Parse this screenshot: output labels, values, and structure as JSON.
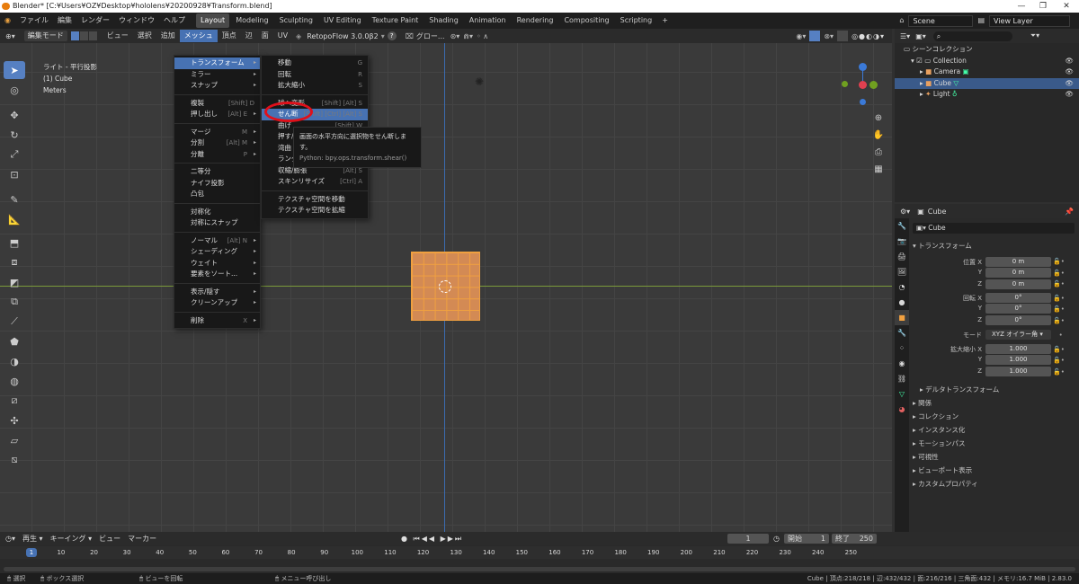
{
  "window": {
    "title": "Blender* [C:¥Users¥OZ¥Desktop¥hololens¥20200928¥Transform.blend]",
    "minimize": "—",
    "maximize": "❐",
    "close": "✕"
  },
  "topbar": {
    "menus": [
      "ファイル",
      "編集",
      "レンダー",
      "ウィンドウ",
      "ヘルプ"
    ],
    "workspaces": [
      "Layout",
      "Modeling",
      "Sculpting",
      "UV Editing",
      "Texture Paint",
      "Shading",
      "Animation",
      "Rendering",
      "Compositing",
      "Scripting"
    ],
    "active_workspace": "Layout",
    "scene": "Scene",
    "view_layer": "View Layer"
  },
  "viewport_header": {
    "mode": "編集モード",
    "menus": [
      "ビュー",
      "選択",
      "追加",
      "メッシュ",
      "頂点",
      "辺",
      "面",
      "UV"
    ],
    "addon": "RetopoFlow 3.0.0β2",
    "transform_orientation": "グロー...",
    "options": "オプション"
  },
  "viewport_info": {
    "line1": "ライト - 平行投影",
    "line2": "(1) Cube",
    "line3": "Meters"
  },
  "mesh_menu": {
    "items": [
      {
        "label": "トランスフォーム",
        "shortcut": "",
        "submenu": true,
        "highlight": true
      },
      {
        "label": "ミラー",
        "shortcut": "",
        "submenu": true
      },
      {
        "label": "スナップ",
        "shortcut": "",
        "submenu": true
      },
      {
        "sep": true
      },
      {
        "label": "複製",
        "shortcut": "[Shift] D"
      },
      {
        "label": "押し出し",
        "shortcut": "[Alt] E",
        "submenu": true
      },
      {
        "sep": true
      },
      {
        "label": "マージ",
        "shortcut": "M",
        "submenu": true
      },
      {
        "label": "分割",
        "shortcut": "[Alt] M",
        "submenu": true
      },
      {
        "label": "分離",
        "shortcut": "P",
        "submenu": true
      },
      {
        "sep": true
      },
      {
        "label": "二等分",
        "shortcut": ""
      },
      {
        "label": "ナイフ投影",
        "shortcut": ""
      },
      {
        "label": "凸包",
        "shortcut": ""
      },
      {
        "sep": true
      },
      {
        "label": "対称化",
        "shortcut": ""
      },
      {
        "label": "対称にスナップ",
        "shortcut": ""
      },
      {
        "sep": true
      },
      {
        "label": "ノーマル",
        "shortcut": "[Alt] N",
        "submenu": true
      },
      {
        "label": "シェーディング",
        "shortcut": "",
        "submenu": true
      },
      {
        "label": "ウェイト",
        "shortcut": "",
        "submenu": true
      },
      {
        "label": "要素をソート...",
        "shortcut": "",
        "submenu": true
      },
      {
        "sep": true
      },
      {
        "label": "表示/隠す",
        "shortcut": "",
        "submenu": true
      },
      {
        "label": "クリーンアップ",
        "shortcut": "",
        "submenu": true
      },
      {
        "sep": true
      },
      {
        "label": "削除",
        "shortcut": "X",
        "submenu": true
      }
    ]
  },
  "transform_submenu": {
    "items": [
      {
        "label": "移動",
        "shortcut": "G"
      },
      {
        "label": "回転",
        "shortcut": "R"
      },
      {
        "label": "拡大縮小",
        "shortcut": "S"
      },
      {
        "sep": true
      },
      {
        "label": "球へ変形",
        "shortcut": "[Shift] [Alt] S"
      },
      {
        "label": "せん断",
        "shortcut": "[Shift] [Ctrl] [Alt] S",
        "highlight": true
      },
      {
        "label": "曲げ",
        "shortcut": "[Shift] W"
      },
      {
        "label": "押す/引く",
        "shortcut": ""
      },
      {
        "label": "湾曲",
        "shortcut": ""
      },
      {
        "label": "ランダム化",
        "shortcut": ""
      },
      {
        "label": "収縮/膨張",
        "shortcut": "[Alt] S"
      },
      {
        "label": "スキンリサイズ",
        "shortcut": "[Ctrl] A"
      },
      {
        "sep": true
      },
      {
        "label": "テクスチャ空間を移動",
        "shortcut": ""
      },
      {
        "label": "テクスチャ空間を拡縮",
        "shortcut": ""
      }
    ]
  },
  "tooltip": {
    "line1": "画面の水平方向に選択物をせん断します。",
    "line2": "Python: bpy.ops.transform.shear()"
  },
  "outliner": {
    "root": "シーンコレクション",
    "collection": "Collection",
    "items": [
      "Camera",
      "Cube",
      "Light"
    ],
    "selected": "Cube"
  },
  "properties": {
    "header_object": "Cube",
    "object_name": "Cube",
    "transform_title": "トランスフォーム",
    "location_label": "位置 X",
    "rotation_label": "回転 X",
    "scale_label": "拡大縮小 X",
    "axis_y": "Y",
    "axis_z": "Z",
    "location": [
      "0 m",
      "0 m",
      "0 m"
    ],
    "rotation": [
      "0°",
      "0°",
      "0°"
    ],
    "scale": [
      "1.000",
      "1.000",
      "1.000"
    ],
    "mode_label": "モード",
    "mode_value": "XYZ オイラー角",
    "delta": "デルタトランスフォーム",
    "sections": [
      "関係",
      "コレクション",
      "インスタンス化",
      "モーションパス",
      "可視性",
      "ビューポート表示",
      "カスタムプロパティ"
    ]
  },
  "timeline": {
    "menus": [
      "再生",
      "キーイング",
      "ビュー",
      "マーカー"
    ],
    "current_frame": "1",
    "start_label": "開始",
    "start": "1",
    "end_label": "終了",
    "end": "250",
    "ruler": [
      "1",
      "10",
      "20",
      "30",
      "40",
      "50",
      "60",
      "70",
      "80",
      "90",
      "100",
      "110",
      "120",
      "130",
      "140",
      "150",
      "160",
      "170",
      "180",
      "190",
      "200",
      "210",
      "220",
      "230",
      "240",
      "250"
    ]
  },
  "statusbar": {
    "left1": "選択",
    "left2": "ボックス選択",
    "left3": "ビューを回転",
    "left4": "メニュー呼び出し",
    "right": "Cube | 頂点:218/218 | 辺:432/432 | 面:216/216 | 三角面:432 | メモリ:16.7 MiB | 2.83.0"
  }
}
